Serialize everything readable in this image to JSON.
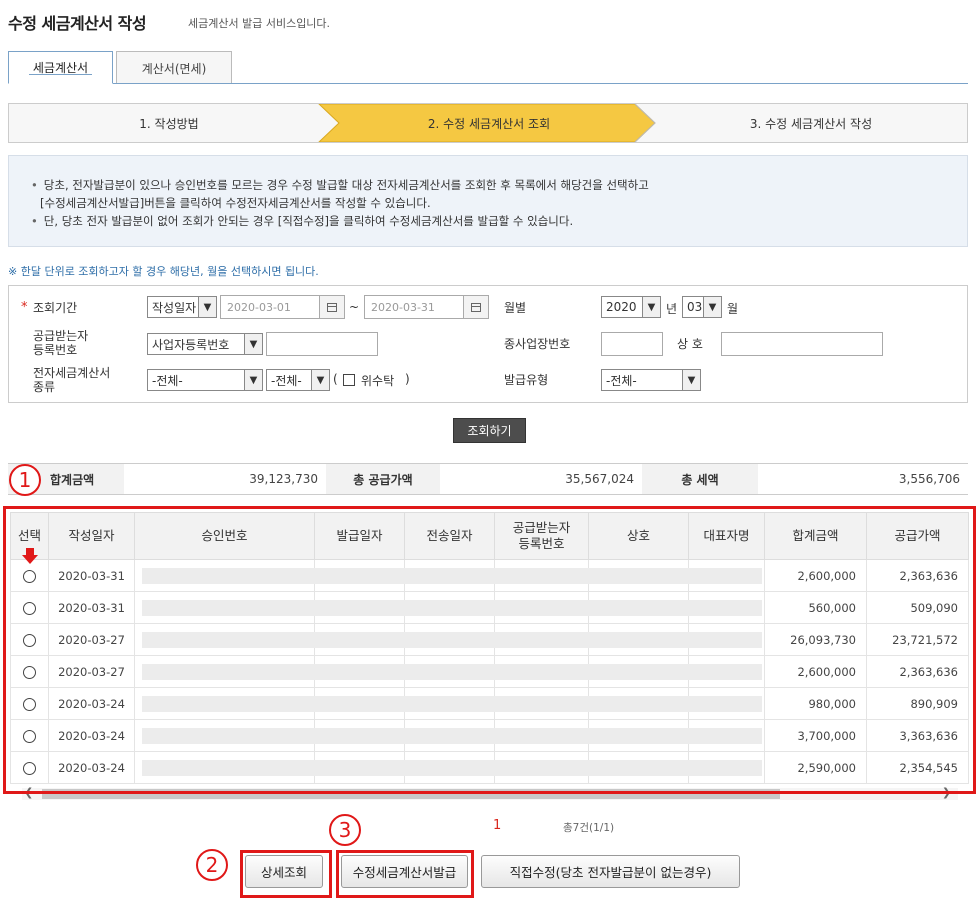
{
  "header": {
    "title": "수정 세금계산서 작성",
    "subtitle": "세금계산서 발급 서비스입니다."
  },
  "tabs": [
    {
      "label": "세금계산서",
      "active": true
    },
    {
      "label": "계산서(면세)",
      "active": false
    }
  ],
  "steps": [
    {
      "label": "1. 작성방법",
      "active": false
    },
    {
      "label": "2. 수정 세금계산서 조회",
      "active": true
    },
    {
      "label": "3. 수정 세금계산서 작성",
      "active": false
    }
  ],
  "info": {
    "lines": [
      "당초, 전자발급분이 있으나 승인번호를 모르는 경우 수정 발급할 대상 전자세금계산서를 조회한 후 목록에서 해당건을 선택하고",
      "[수정세금계산서발급]버튼을 클릭하여 수정전자세금계산서를 작성할 수 있습니다.",
      "단, 당초 전자 발급분이 없어 조회가 안되는 경우 [직접수정]을 클릭하여 수정세금계산서를 발급할 수 있습니다."
    ],
    "note": "※ 한달 단위로 조회하고자 할 경우 해당년, 월을 선택하시면 됩니다."
  },
  "form": {
    "required_mark": "*",
    "period_label": "조회기간",
    "period_type": "작성일자",
    "date_from": "2020-03-01",
    "tilde": "~",
    "date_to": "2020-03-31",
    "monthly_label": "월별",
    "year": "2020",
    "year_suffix": "년",
    "month": "03",
    "month_suffix": "월",
    "recipient_label_1": "공급받는자",
    "recipient_label_2": "등록번호",
    "recipient_type": "사업자등록번호",
    "branch_label": "종사업장번호",
    "company_label": "상 호",
    "kind_label_1": "전자세금계산서",
    "kind_label_2": "종류",
    "kind_select_1": "-전체-",
    "kind_select_2": "-전체-",
    "trust_open": "(",
    "trust_label": "위수탁",
    "trust_close": ")",
    "issue_type_label": "발급유형",
    "issue_type": "-전체-",
    "search_button": "조회하기"
  },
  "summary": {
    "total_label": "합계금액",
    "total_value": "39,123,730",
    "supply_label": "총 공급가액",
    "supply_value": "35,567,024",
    "tax_label": "총 세액",
    "tax_value": "3,556,706"
  },
  "table": {
    "headers": [
      "선택",
      "작성일자",
      "승인번호",
      "발급일자",
      "전송일자",
      "공급받는자\n등록번호",
      "상호",
      "대표자명",
      "합계금액",
      "공급가액"
    ],
    "rows": [
      {
        "date": "2020-03-31",
        "total": "2,600,000",
        "supply": "2,363,636"
      },
      {
        "date": "2020-03-31",
        "total": "560,000",
        "supply": "509,090"
      },
      {
        "date": "2020-03-27",
        "total": "26,093,730",
        "supply": "23,721,572"
      },
      {
        "date": "2020-03-27",
        "total": "2,600,000",
        "supply": "2,363,636"
      },
      {
        "date": "2020-03-24",
        "total": "980,000",
        "supply": "890,909"
      },
      {
        "date": "2020-03-24",
        "total": "3,700,000",
        "supply": "3,363,636"
      },
      {
        "date": "2020-03-24",
        "total": "2,590,000",
        "supply": "2,354,545"
      }
    ]
  },
  "pager": {
    "current": "1",
    "total": "총7건(1/1)"
  },
  "buttons": {
    "detail": "상세조회",
    "issue": "수정세금계산서발급",
    "direct": "직접수정(당초 전자발급분이 없는경우)"
  },
  "annotations": [
    "1",
    "2",
    "3"
  ],
  "colors": {
    "active_step": "#f5c842",
    "annotation_red": "#e01818",
    "info_bg": "#eef3f9"
  }
}
